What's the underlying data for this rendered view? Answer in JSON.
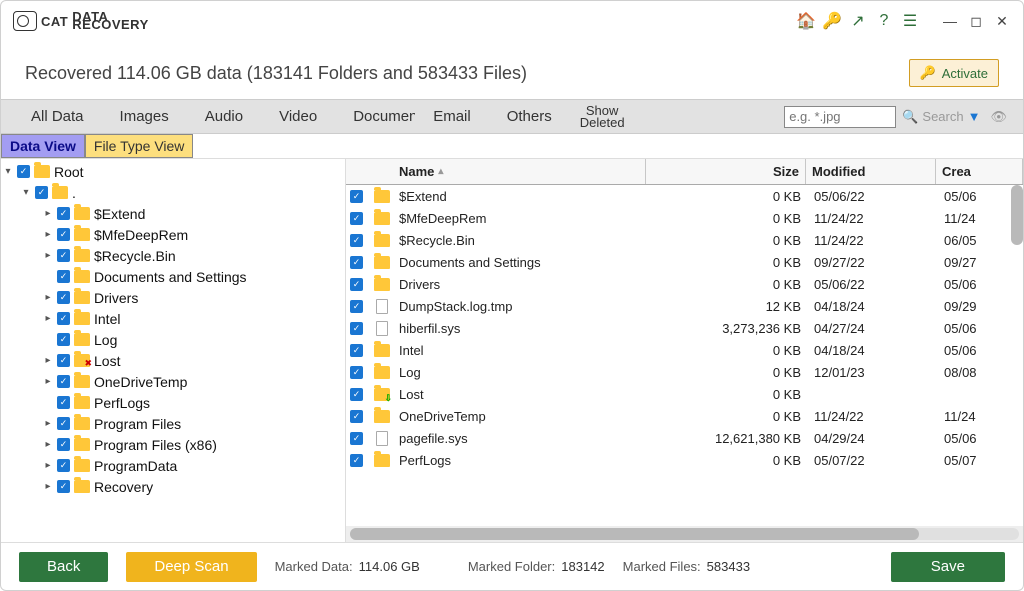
{
  "app": {
    "name_main": "CAT",
    "name_sub1": "DATA",
    "name_sub2": "RECOVERY"
  },
  "titlebar_icons": [
    "home-icon",
    "key-icon",
    "arrow-icon",
    "question-icon",
    "menu-icon"
  ],
  "activate_label": "Activate",
  "summary": "Recovered 114.06 GB data (183141 Folders and 583433 Files)",
  "filters": {
    "all": "All Data",
    "images": "Images",
    "audio": "Audio",
    "video": "Video",
    "documents": "Documents",
    "email": "Email",
    "others": "Others",
    "deleted1": "Show",
    "deleted2": "Deleted"
  },
  "search": {
    "placeholder": "e.g. *.jpg",
    "label": "Search"
  },
  "view_tabs": {
    "data": "Data View",
    "type": "File Type View"
  },
  "tree": {
    "root": "Root",
    "dot": ".",
    "items": [
      "$Extend",
      "$MfeDeepRem",
      "$Recycle.Bin",
      "Documents and Settings",
      "Drivers",
      "Intel",
      "Log",
      "Lost",
      "OneDriveTemp",
      "PerfLogs",
      "Program Files",
      "Program Files (x86)",
      "ProgramData",
      "Recovery"
    ]
  },
  "grid": {
    "headers": {
      "name": "Name",
      "size": "Size",
      "modified": "Modified",
      "created": "Crea"
    },
    "rows": [
      {
        "icon": "folder",
        "name": "$Extend",
        "size": "0 KB",
        "mod": "05/06/22",
        "crt": "05/06"
      },
      {
        "icon": "folder",
        "name": "$MfeDeepRem",
        "size": "0 KB",
        "mod": "11/24/22",
        "crt": "11/24"
      },
      {
        "icon": "folder",
        "name": "$Recycle.Bin",
        "size": "0 KB",
        "mod": "11/24/22",
        "crt": "06/05"
      },
      {
        "icon": "folder",
        "name": "Documents and Settings",
        "size": "0 KB",
        "mod": "09/27/22",
        "crt": "09/27"
      },
      {
        "icon": "folder",
        "name": "Drivers",
        "size": "0 KB",
        "mod": "05/06/22",
        "crt": "05/06"
      },
      {
        "icon": "file",
        "name": "DumpStack.log.tmp",
        "size": "12 KB",
        "mod": "04/18/24",
        "crt": "09/29"
      },
      {
        "icon": "file",
        "name": "hiberfil.sys",
        "size": "3,273,236 KB",
        "mod": "04/27/24",
        "crt": "05/06"
      },
      {
        "icon": "folder",
        "name": "Intel",
        "size": "0 KB",
        "mod": "04/18/24",
        "crt": "05/06"
      },
      {
        "icon": "folder",
        "name": "Log",
        "size": "0 KB",
        "mod": "12/01/23",
        "crt": "08/08"
      },
      {
        "icon": "folder-green",
        "name": "Lost",
        "size": "0 KB",
        "mod": "",
        "crt": ""
      },
      {
        "icon": "folder",
        "name": "OneDriveTemp",
        "size": "0 KB",
        "mod": "11/24/22",
        "crt": "11/24"
      },
      {
        "icon": "file",
        "name": "pagefile.sys",
        "size": "12,621,380 KB",
        "mod": "04/29/24",
        "crt": "05/06"
      },
      {
        "icon": "folder",
        "name": "PerfLogs",
        "size": "0 KB",
        "mod": "05/07/22",
        "crt": "05/07"
      }
    ]
  },
  "footer": {
    "back": "Back",
    "deep": "Deep Scan",
    "marked_data_lbl": "Marked Data:",
    "marked_data_val": "114.06 GB",
    "marked_folder_lbl": "Marked Folder:",
    "marked_folder_val": "183142",
    "marked_files_lbl": "Marked Files:",
    "marked_files_val": "583433",
    "save": "Save"
  }
}
